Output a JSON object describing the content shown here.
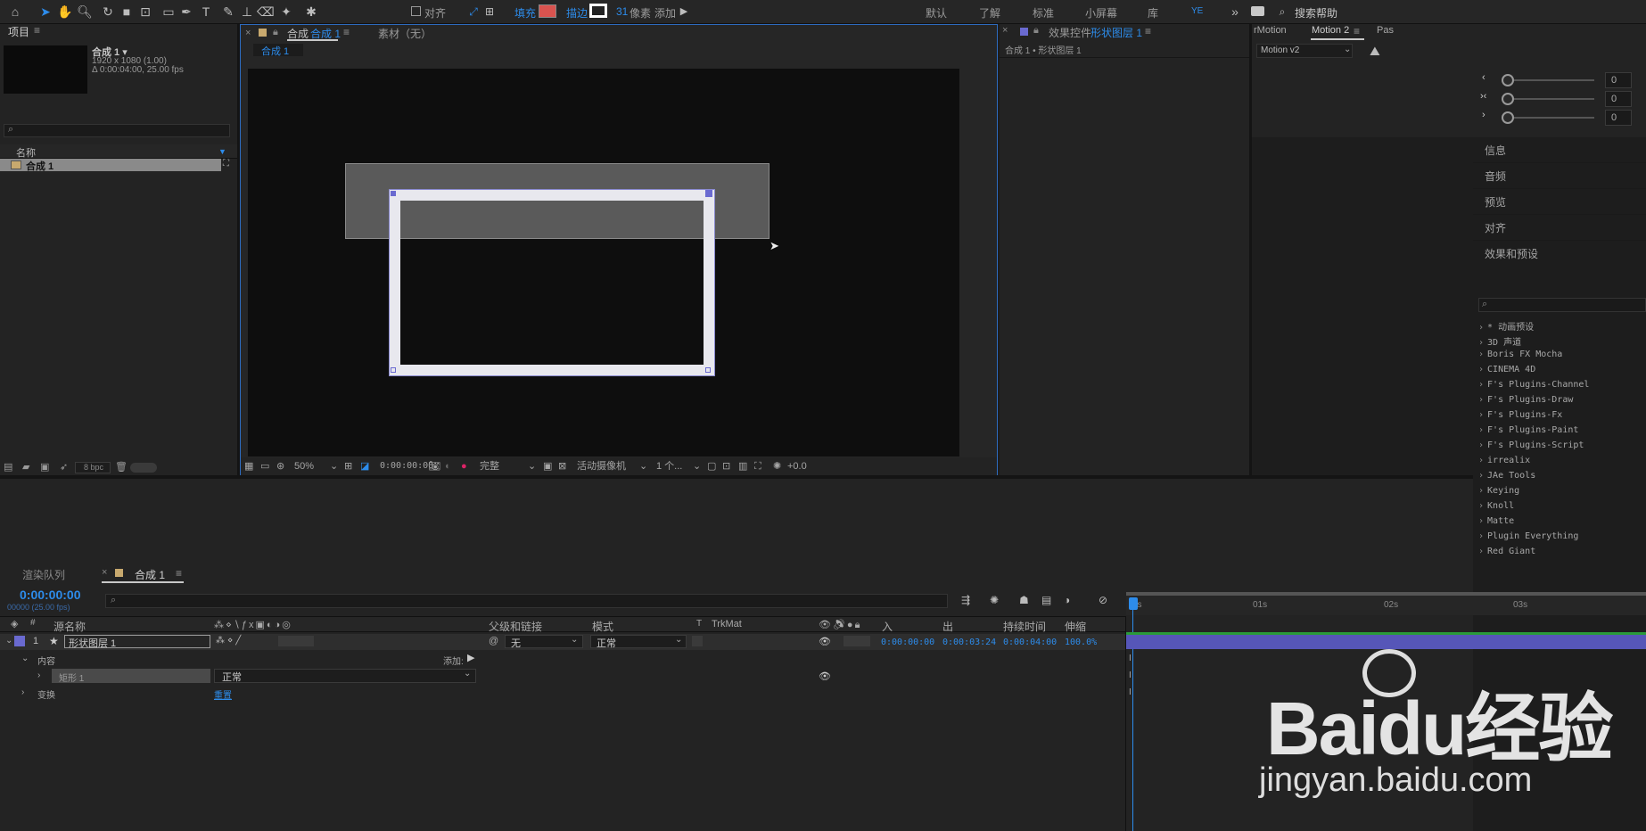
{
  "toolbar": {
    "snap_label": "对齐",
    "fill_label": "填充",
    "stroke_label": "描边",
    "stroke_width": "31",
    "stroke_unit": "像素",
    "add_label": "添加",
    "workspaces": [
      "默认",
      "了解",
      "标准",
      "小屏幕",
      "库"
    ],
    "ye_label": "YE",
    "search_help_placeholder": "搜索帮助",
    "colors": {
      "fill_swatch": "#d9534f",
      "accent": "#2d8ceb"
    }
  },
  "project": {
    "title": "项目",
    "comp_name": "合成 1 ▾",
    "comp_res": "1920 x 1080 (1.00)",
    "comp_duration": "Δ 0:00:04:00, 25.00 fps",
    "col_name": "名称",
    "items": [
      {
        "name": "合成 1"
      }
    ],
    "bpc_label": "8 bpc"
  },
  "composition_panel": {
    "tab_prefix": "合成",
    "tab_active": "合成 1",
    "tab_footage": "素材（无）",
    "breadcrumb": "合成 1",
    "zoom": "50%",
    "timecode": "0:00:00:00",
    "quality": "完整",
    "camera": "活动摄像机",
    "views": "1 个...",
    "exposure": "+0.0"
  },
  "effects_controls": {
    "title": "效果控件",
    "layer_name": "形状图层 1",
    "breadcrumb": "合成 1 • 形状图层 1"
  },
  "motion_panel": {
    "tab1": "rMotion",
    "tab2": "Motion 2",
    "tab3": "Pas",
    "version": "Motion v2",
    "sliders": [
      {
        "value": "0"
      },
      {
        "value": "0"
      },
      {
        "value": "0"
      }
    ]
  },
  "right_panels": [
    "信息",
    "音频",
    "预览",
    "对齐",
    "效果和预设"
  ],
  "effects_presets": [
    "* 动画预设",
    "3D 声道",
    "Boris FX Mocha",
    "CINEMA 4D",
    "F's Plugins-Channel",
    "F's Plugins-Draw",
    "F's Plugins-Fx",
    "F's Plugins-Paint",
    "F's Plugins-Script",
    "irrealix",
    "JAe Tools",
    "Keying",
    "Knoll",
    "Matte",
    "Plugin Everything",
    "Red Giant"
  ],
  "timeline": {
    "tab_render": "渲染队列",
    "tab_comp": "合成 1",
    "current_time": "0:00:00:00",
    "frame_info": "00000 (25.00 fps)",
    "columns": {
      "source_name": "源名称",
      "parent": "父级和链接",
      "mode": "模式",
      "t": "T",
      "trkmat": "TrkMat",
      "in": "入",
      "out": "出",
      "duration": "持续时间",
      "stretch": "伸缩"
    },
    "layer": {
      "index": "1",
      "name": "形状图层 1",
      "parent": "无",
      "mode": "正常",
      "in": "0:00:00:00",
      "out": "0:00:03:24",
      "duration": "0:00:04:00",
      "stretch": "100.0%"
    },
    "contents_label": "内容",
    "add_label": "添加:",
    "rect_label": "矩形 1",
    "rect_mode": "正常",
    "transform_label": "变换",
    "reset_label": "重置",
    "ruler": [
      "0s",
      "01s",
      "02s",
      "03s"
    ]
  },
  "watermark": {
    "brand": "Baidu经验",
    "url": "jingyan.baidu.com"
  }
}
